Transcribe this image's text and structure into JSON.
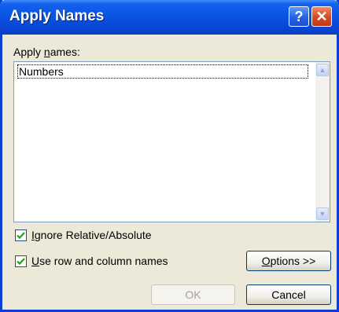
{
  "window": {
    "title": "Apply Names",
    "help_glyph": "?",
    "close_glyph": "✕"
  },
  "apply_names": {
    "label_prefix": "Apply ",
    "label_accel": "n",
    "label_suffix": "ames:",
    "items": [
      "Numbers"
    ],
    "selected_item": "Numbers",
    "scroll_up_glyph": "▲",
    "scroll_down_glyph": "▼"
  },
  "options": {
    "ignore_relative_absolute": {
      "accel": "I",
      "rest": "gnore Relative/Absolute",
      "checked": true
    },
    "use_row_column_names": {
      "accel": "U",
      "rest": "se row and column names",
      "checked": true
    }
  },
  "buttons": {
    "options_accel": "O",
    "options_rest": "ptions >>",
    "ok": "OK",
    "ok_disabled": true,
    "cancel": "Cancel"
  },
  "colors": {
    "titlebar": "#0a54e3",
    "dialog_bg": "#ece9d8",
    "check_mark": "#21a121"
  }
}
